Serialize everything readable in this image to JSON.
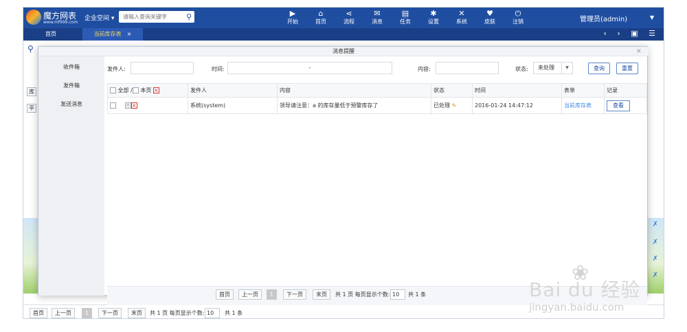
{
  "app": {
    "brand": "魔方网表",
    "brand_url": "www.mf999.com",
    "space_menu": "企业空间 ▾",
    "search_placeholder": "请输入查询关键字",
    "admin": "管理员(admin)"
  },
  "nav": [
    {
      "label": "开始",
      "icon": "▶"
    },
    {
      "label": "首页",
      "icon": "⌂"
    },
    {
      "label": "流程",
      "icon": "⋖"
    },
    {
      "label": "消息",
      "icon": "✉"
    },
    {
      "label": "任务",
      "icon": "▤"
    },
    {
      "label": "设置",
      "icon": "✱"
    },
    {
      "label": "系统",
      "icon": "✕"
    },
    {
      "label": "皮肤",
      "icon": "♥"
    },
    {
      "label": "注销",
      "icon": "⏻"
    }
  ],
  "tabs": {
    "home": "首页",
    "stock": "当前库存表",
    "close": "×",
    "controls": "‹ › ▣ ☰"
  },
  "bg": {
    "side1": "库",
    "side2": "平",
    "pager": {
      "first": "首页",
      "prev": "上一页",
      "page": "1",
      "next": "下一页",
      "last": "末页",
      "info": "共 1 页 每页显示个数:",
      "size": "10",
      "total": "共 1 条"
    }
  },
  "modal": {
    "title": "消息提醒",
    "close": "×",
    "side": [
      "收件箱",
      "发件箱",
      "发送消息"
    ],
    "filters": {
      "sender_label": "发件人:",
      "time_label": "时间:",
      "time_value": "-",
      "content_label": "内容:",
      "state_label": "状态:",
      "state_value": "未处理",
      "query": "查询",
      "reset": "重置"
    },
    "table": {
      "headers": {
        "all": "全部",
        "slash": "/",
        "page": "本页",
        "sender": "发件人",
        "content": "内容",
        "state": "状态",
        "time": "时间",
        "form": "表单",
        "record": "记录"
      },
      "rows": [
        {
          "sender": "系统(system)",
          "content": "领导请注意：a 的库存量低于预警库存了",
          "state": "已处理",
          "time": "2016-01-24 14:47:12",
          "form": "当前库存表",
          "action": "查看"
        }
      ]
    },
    "pager": {
      "first": "首页",
      "prev": "上一页",
      "page": "1",
      "next": "下一页",
      "last": "末页",
      "info": "共 1 页 每页显示个数:",
      "size": "10",
      "total": "共 1 条"
    }
  },
  "watermark": {
    "text": "Bai du 经验",
    "url": "jingyan.baidu.com"
  }
}
